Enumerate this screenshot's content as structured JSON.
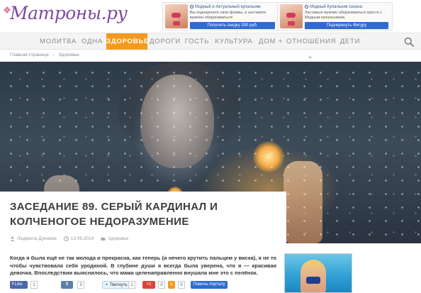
{
  "header": {
    "logo_text": "Матроны.ру",
    "ads": [
      {
        "title": "Модный и Актуальный купальник",
        "text": "Вы подчеркнете свои формы, и заставите мужчин оборачиваться!",
        "button": "Получить скидку 300 руб."
      },
      {
        "title": "Модный Купальник сезона",
        "text": "Заставьте мужчин оборачиваться просто с Модным купальником.",
        "button": "Подчеркнуть Фигуру"
      }
    ]
  },
  "nav": {
    "items": [
      "МОЛИТВА",
      "ОДНА",
      "ЗДОРОВЬЕ",
      "ДОРОГИ",
      "ГОСТЬ",
      "КУЛЬТУРА",
      "ДОМ +",
      "ОТНОШЕНИЯ +",
      "ДЕТИ"
    ],
    "active": "ЗДОРОВЬЕ"
  },
  "breadcrumb": [
    "Главная страница",
    "Здоровье"
  ],
  "article": {
    "title": "ЗАСЕДАНИЕ 89. СЕРЫЙ КАРДИНАЛ И КОЛЧЕНОГОЕ НЕДОРАЗУМЕНИЕ",
    "author": "Людмила Дунаева",
    "date": "13.06.2014",
    "category": "Здоровье",
    "lead": "Когда я была ещё не так молода и прекрасна, как теперь (и нечего крутить пальцем у виска), я не то чтобы чувствовала себя уродиной. В глубине души я всегда была уверена, что я — красивая девочка. Впоследствии выяснилось, что мама целенаправленно внушала мне это с пелёнок."
  },
  "share": {
    "like_label": "Like",
    "like_count": "1",
    "vk_label": "B",
    "vk_count": "3",
    "tweet_label": "Твитнуть",
    "tweet_count": "1",
    "gplus_label": "+1",
    "gplus_count": "0",
    "ok_count": "0",
    "help_label": "Помочь порталу"
  },
  "colors": {
    "accent": "#f39a1d",
    "logo": "#7d4a9c",
    "ad_button": "#2f6bd0"
  }
}
